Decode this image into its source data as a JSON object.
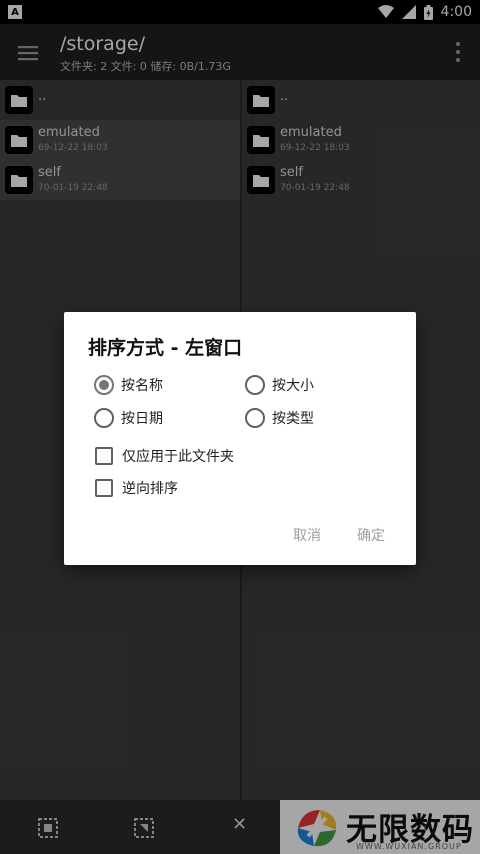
{
  "status_bar": {
    "time": "4:00",
    "notification_icon": "A"
  },
  "app_bar": {
    "path": "/storage/",
    "subtitle": "文件夹: 2  文件: 0  储存: 0B/1.73G"
  },
  "left_pane": {
    "items": [
      {
        "name": "..",
        "date": ""
      },
      {
        "name": "emulated",
        "date": "69-12-22 18:03"
      },
      {
        "name": "self",
        "date": "70-01-19 22:48"
      }
    ]
  },
  "right_pane": {
    "items": [
      {
        "name": "..",
        "date": ""
      },
      {
        "name": "emulated",
        "date": "69-12-22 18:03"
      },
      {
        "name": "self",
        "date": "70-01-19 22:48"
      }
    ]
  },
  "dialog": {
    "title": "排序方式 - 左窗口",
    "options": [
      {
        "label": "按名称",
        "selected": true
      },
      {
        "label": "按大小",
        "selected": false
      },
      {
        "label": "按日期",
        "selected": false
      },
      {
        "label": "按类型",
        "selected": false
      }
    ],
    "checkboxes": [
      {
        "label": "仅应用于此文件夹",
        "checked": false
      },
      {
        "label": "逆向排序",
        "checked": false
      }
    ],
    "cancel_label": "取消",
    "ok_label": "确定"
  },
  "watermark": {
    "name": "无限数码",
    "sub": "WWW.WUXIAN.GROUP"
  }
}
